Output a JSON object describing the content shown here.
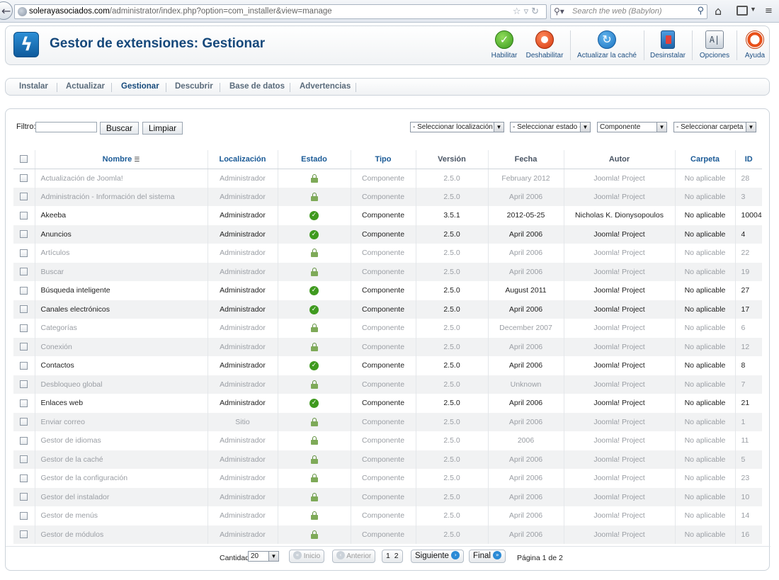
{
  "browser": {
    "url_host": "solerayasociados.com",
    "url_path": "/administrator/index.php?option=com_installer&view=manage",
    "search_placeholder": "Search the web (Babylon)"
  },
  "header": {
    "title": "Gestor de extensiones: Gestionar",
    "toolbar": {
      "enable": "Habilitar",
      "disable": "Deshabilitar",
      "refresh_cache": "Actualizar la caché",
      "uninstall": "Desinstalar",
      "options": "Opciones",
      "help": "Ayuda"
    }
  },
  "submenu": {
    "install": "Instalar",
    "update": "Actualizar",
    "manage": "Gestionar",
    "discover": "Descubrir",
    "database": "Base de datos",
    "warnings": "Advertencias"
  },
  "filter": {
    "label": "Filtro:",
    "value": "",
    "search_button": "Buscar",
    "clear_button": "Limpiar",
    "location_select": "- Seleccionar localización -",
    "state_select": "- Seleccionar estado -",
    "type_select": "Componente",
    "folder_select": "- Seleccionar carpeta -"
  },
  "columns": {
    "name": "Nombre",
    "location": "Localización",
    "state": "Estado",
    "type": "Tipo",
    "version": "Versión",
    "date": "Fecha",
    "author": "Autor",
    "folder": "Carpeta",
    "id": "ID"
  },
  "rows": [
    {
      "name": "Actualización de Joomla!",
      "location": "Administrador",
      "state": "locked",
      "type": "Componente",
      "version": "2.5.0",
      "date": "February 2012",
      "author": "Joomla! Project",
      "folder": "No aplicable",
      "id": "28"
    },
    {
      "name": "Administración - Información del sistema",
      "location": "Administrador",
      "state": "locked",
      "type": "Componente",
      "version": "2.5.0",
      "date": "April 2006",
      "author": "Joomla! Project",
      "folder": "No aplicable",
      "id": "3"
    },
    {
      "name": "Akeeba",
      "location": "Administrador",
      "state": "enabled",
      "type": "Componente",
      "version": "3.5.1",
      "date": "2012-05-25",
      "author": "Nicholas K. Dionysopoulos",
      "folder": "No aplicable",
      "id": "10004"
    },
    {
      "name": "Anuncios",
      "location": "Administrador",
      "state": "enabled",
      "type": "Componente",
      "version": "2.5.0",
      "date": "April 2006",
      "author": "Joomla! Project",
      "folder": "No aplicable",
      "id": "4"
    },
    {
      "name": "Artículos",
      "location": "Administrador",
      "state": "locked",
      "type": "Componente",
      "version": "2.5.0",
      "date": "April 2006",
      "author": "Joomla! Project",
      "folder": "No aplicable",
      "id": "22"
    },
    {
      "name": "Buscar",
      "location": "Administrador",
      "state": "locked",
      "type": "Componente",
      "version": "2.5.0",
      "date": "April 2006",
      "author": "Joomla! Project",
      "folder": "No aplicable",
      "id": "19"
    },
    {
      "name": "Búsqueda inteligente",
      "location": "Administrador",
      "state": "enabled",
      "type": "Componente",
      "version": "2.5.0",
      "date": "August 2011",
      "author": "Joomla! Project",
      "folder": "No aplicable",
      "id": "27"
    },
    {
      "name": "Canales electrónicos",
      "location": "Administrador",
      "state": "enabled",
      "type": "Componente",
      "version": "2.5.0",
      "date": "April 2006",
      "author": "Joomla! Project",
      "folder": "No aplicable",
      "id": "17"
    },
    {
      "name": "Categorías",
      "location": "Administrador",
      "state": "locked",
      "type": "Componente",
      "version": "2.5.0",
      "date": "December 2007",
      "author": "Joomla! Project",
      "folder": "No aplicable",
      "id": "6"
    },
    {
      "name": "Conexión",
      "location": "Administrador",
      "state": "locked",
      "type": "Componente",
      "version": "2.5.0",
      "date": "April 2006",
      "author": "Joomla! Project",
      "folder": "No aplicable",
      "id": "12"
    },
    {
      "name": "Contactos",
      "location": "Administrador",
      "state": "enabled",
      "type": "Componente",
      "version": "2.5.0",
      "date": "April 2006",
      "author": "Joomla! Project",
      "folder": "No aplicable",
      "id": "8"
    },
    {
      "name": "Desbloqueo global",
      "location": "Administrador",
      "state": "locked",
      "type": "Componente",
      "version": "2.5.0",
      "date": "Unknown",
      "author": "Joomla! Project",
      "folder": "No aplicable",
      "id": "7"
    },
    {
      "name": "Enlaces web",
      "location": "Administrador",
      "state": "enabled",
      "type": "Componente",
      "version": "2.5.0",
      "date": "April 2006",
      "author": "Joomla! Project",
      "folder": "No aplicable",
      "id": "21"
    },
    {
      "name": "Enviar correo",
      "location": "Sitio",
      "state": "locked",
      "type": "Componente",
      "version": "2.5.0",
      "date": "April 2006",
      "author": "Joomla! Project",
      "folder": "No aplicable",
      "id": "1"
    },
    {
      "name": "Gestor de idiomas",
      "location": "Administrador",
      "state": "locked",
      "type": "Componente",
      "version": "2.5.0",
      "date": "2006",
      "author": "Joomla! Project",
      "folder": "No aplicable",
      "id": "11"
    },
    {
      "name": "Gestor de la caché",
      "location": "Administrador",
      "state": "locked",
      "type": "Componente",
      "version": "2.5.0",
      "date": "April 2006",
      "author": "Joomla! Project",
      "folder": "No aplicable",
      "id": "5"
    },
    {
      "name": "Gestor de la configuración",
      "location": "Administrador",
      "state": "locked",
      "type": "Componente",
      "version": "2.5.0",
      "date": "April 2006",
      "author": "Joomla! Project",
      "folder": "No aplicable",
      "id": "23"
    },
    {
      "name": "Gestor del instalador",
      "location": "Administrador",
      "state": "locked",
      "type": "Componente",
      "version": "2.5.0",
      "date": "April 2006",
      "author": "Joomla! Project",
      "folder": "No aplicable",
      "id": "10"
    },
    {
      "name": "Gestor de menús",
      "location": "Administrador",
      "state": "locked",
      "type": "Componente",
      "version": "2.5.0",
      "date": "April 2006",
      "author": "Joomla! Project",
      "folder": "No aplicable",
      "id": "14"
    },
    {
      "name": "Gestor de módulos",
      "location": "Administrador",
      "state": "locked",
      "type": "Componente",
      "version": "2.5.0",
      "date": "April 2006",
      "author": "Joomla! Project",
      "folder": "No aplicable",
      "id": "16"
    }
  ],
  "pagination": {
    "limit_label": "Cantidad",
    "limit_value": "20",
    "start": "Inicio",
    "prev": "Anterior",
    "page1": "1",
    "page2": "2",
    "next": "Siguiente",
    "end": "Final",
    "page_info": "Página 1 de 2"
  },
  "colors": {
    "title": "#15487b",
    "enabled_icon": "#3f9a1f",
    "link": "#1a5a96"
  }
}
